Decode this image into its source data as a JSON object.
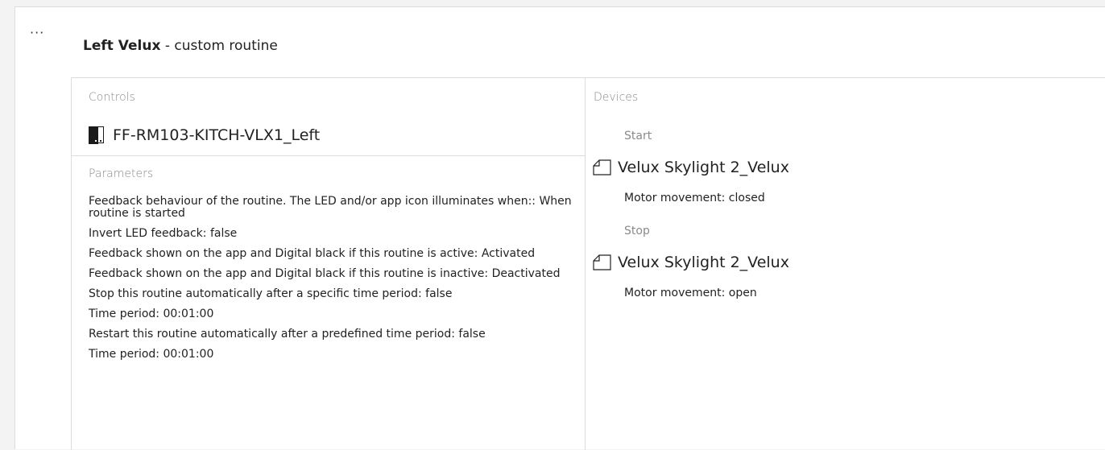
{
  "header": {
    "more_label": "···",
    "device_name": "Left Velux",
    "suffix": " - custom routine"
  },
  "controls": {
    "label": "Controls",
    "device_label": "FF-RM103-KITCH-VLX1_Left",
    "device_icon": "window-icon"
  },
  "parameters": {
    "label": "Parameters",
    "items": [
      "Feedback behaviour of the routine. The LED and/or app icon illuminates when:: When routine is started",
      "Invert LED feedback: false",
      "Feedback shown on the app and Digital black if this routine is active: Activated",
      "Feedback shown on the app and Digital black if this routine is inactive: Deactivated",
      "Stop this routine automatically after a specific time period: false",
      "Time period: 00:01:00",
      "Restart this routine automatically after a predefined time period: false",
      "Time period: 00:01:00"
    ]
  },
  "devices": {
    "label": "Devices",
    "start": {
      "label": "Start",
      "device": "Velux Skylight 2_Velux",
      "detail": "Motor movement: closed",
      "icon": "house-icon"
    },
    "stop": {
      "label": "Stop",
      "device": "Velux Skylight 2_Velux",
      "detail": "Motor movement: open",
      "icon": "house-icon"
    }
  }
}
